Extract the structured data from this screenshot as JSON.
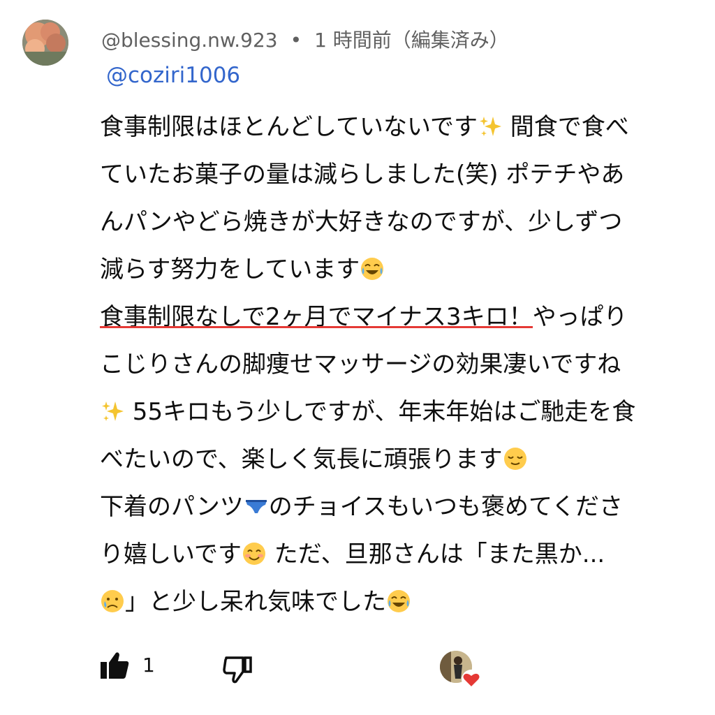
{
  "comment": {
    "author": "@blessing.nw.923",
    "separator": "•",
    "time": "1 時間前（編集済み）",
    "mention": "@coziri1006",
    "lines": [
      {
        "text": "食事制限はほとんどしていないです",
        "emoji": "sparkles",
        "tail": " 間食で食べ"
      },
      {
        "text": "ていたお菓子の量は減らしました(笑)  ポテチやあ"
      },
      {
        "text": "んパンやどら焼きが大好きなのですが、少しずつ"
      },
      {
        "text": "減らす努力をしています",
        "emoji": "joy"
      },
      {
        "highlight": "食事制限なしで2ヶ月でマイナス3キロ！",
        "tail": "やっぱり"
      },
      {
        "text": "こじりさんの脚痩せマッサージの効果凄いですね"
      },
      {
        "lead_emoji": "sparkles",
        "text": " 55キロもう少しですが、年末年始はご馳走を食"
      },
      {
        "text": "べたいので、楽しく気長に頑張ります",
        "emoji": "relieved"
      },
      {
        "text": "下着のパンツ",
        "emoji": "briefs",
        "tail": "のチョイスもいつも褒めてくださ"
      },
      {
        "text": "り嬉しいです",
        "emoji": "blush",
        "tail": " ただ、旦那さんは「また黒か..."
      },
      {
        "lead_emoji": "sad",
        "text": "」と少し呆れ気味でした",
        "emoji": "joy"
      }
    ]
  },
  "actions": {
    "like_count": "1",
    "like_icon": "thumbs-up-filled-icon",
    "dislike_icon": "thumbs-down-outline-icon",
    "creator_heart_icon": "heart-icon"
  },
  "colors": {
    "mention": "#3366cc",
    "meta": "#606060",
    "underline": "#e53935",
    "heart": "#e53935"
  }
}
